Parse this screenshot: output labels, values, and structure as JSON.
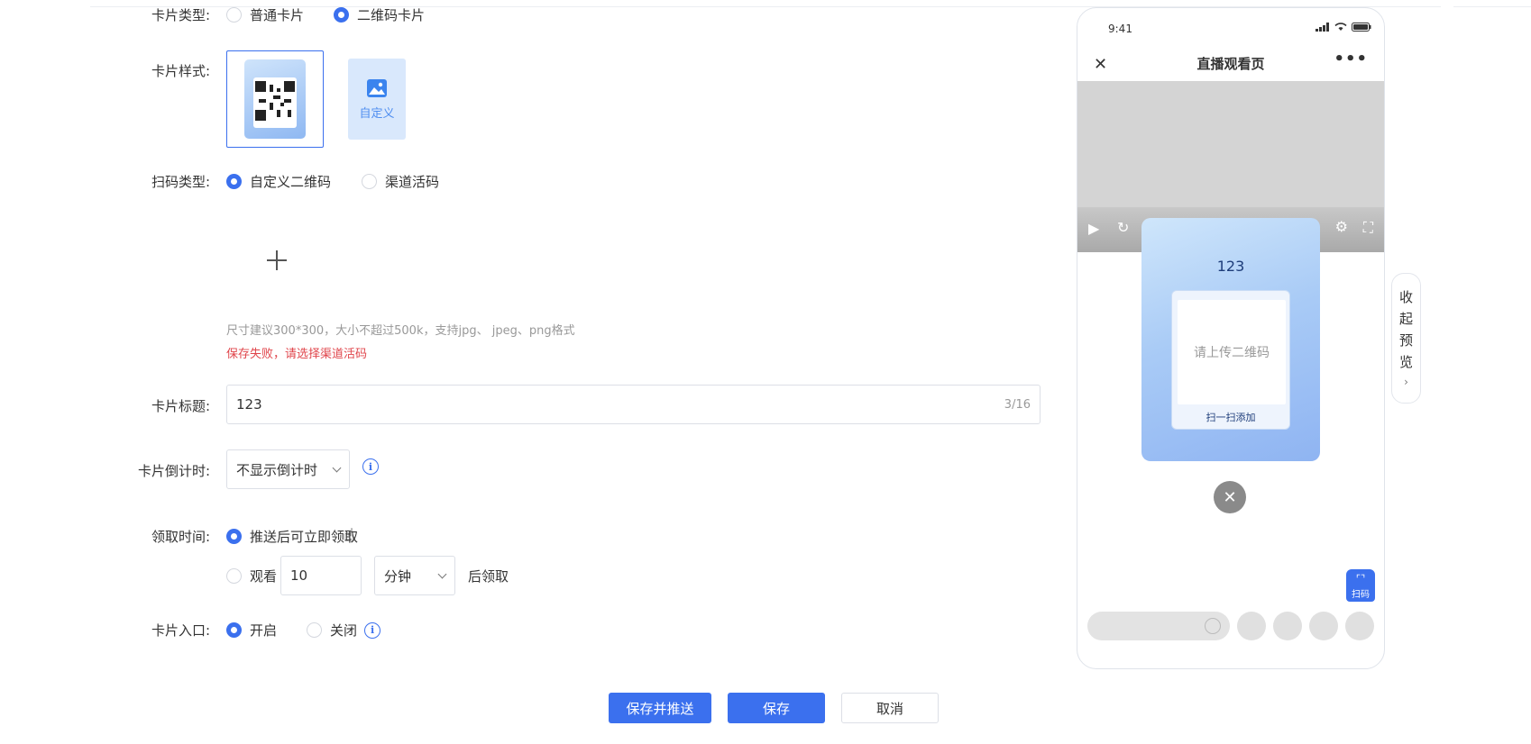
{
  "form": {
    "card_type": {
      "label": "卡片类型:",
      "options": [
        "普通卡片",
        "二维码卡片"
      ],
      "selected": 1
    },
    "card_style": {
      "label": "卡片样式:",
      "custom_label": "自定义"
    },
    "scan_type": {
      "label": "扫码类型:",
      "options": [
        "自定义二维码",
        "渠道活码"
      ],
      "selected": 0
    },
    "upload": {
      "hint": "尺寸建议300*300，大小不超过500k，支持jpg、 jpeg、png格式",
      "error": "保存失败，请选择渠道活码"
    },
    "card_title": {
      "label": "卡片标题:",
      "value": "123",
      "count": "3/16"
    },
    "countdown": {
      "label": "卡片倒计时:",
      "value": "不显示倒计时"
    },
    "claim_time": {
      "label": "领取时间:",
      "option1": "推送后可立即领取",
      "option2_prefix": "观看",
      "minutes_value": "10",
      "unit": "分钟",
      "option2_suffix": "后领取",
      "selected": 0
    },
    "entry": {
      "label": "卡片入口:",
      "options": [
        "开启",
        "关闭"
      ],
      "selected": 0
    }
  },
  "buttons": {
    "save_push": "保存并推送",
    "save": "保存",
    "cancel": "取消"
  },
  "preview": {
    "time": "9:41",
    "nav_title": "直播观看页",
    "card_title": "123",
    "qr_placeholder": "请上传二维码",
    "scan_text": "扫一扫添加",
    "scan_fab": "扫码",
    "collapse": [
      "收",
      "起",
      "预",
      "览"
    ],
    "collapse_arrow": "›"
  },
  "colors": {
    "primary": "#3b70ee",
    "error": "#e0454b"
  }
}
